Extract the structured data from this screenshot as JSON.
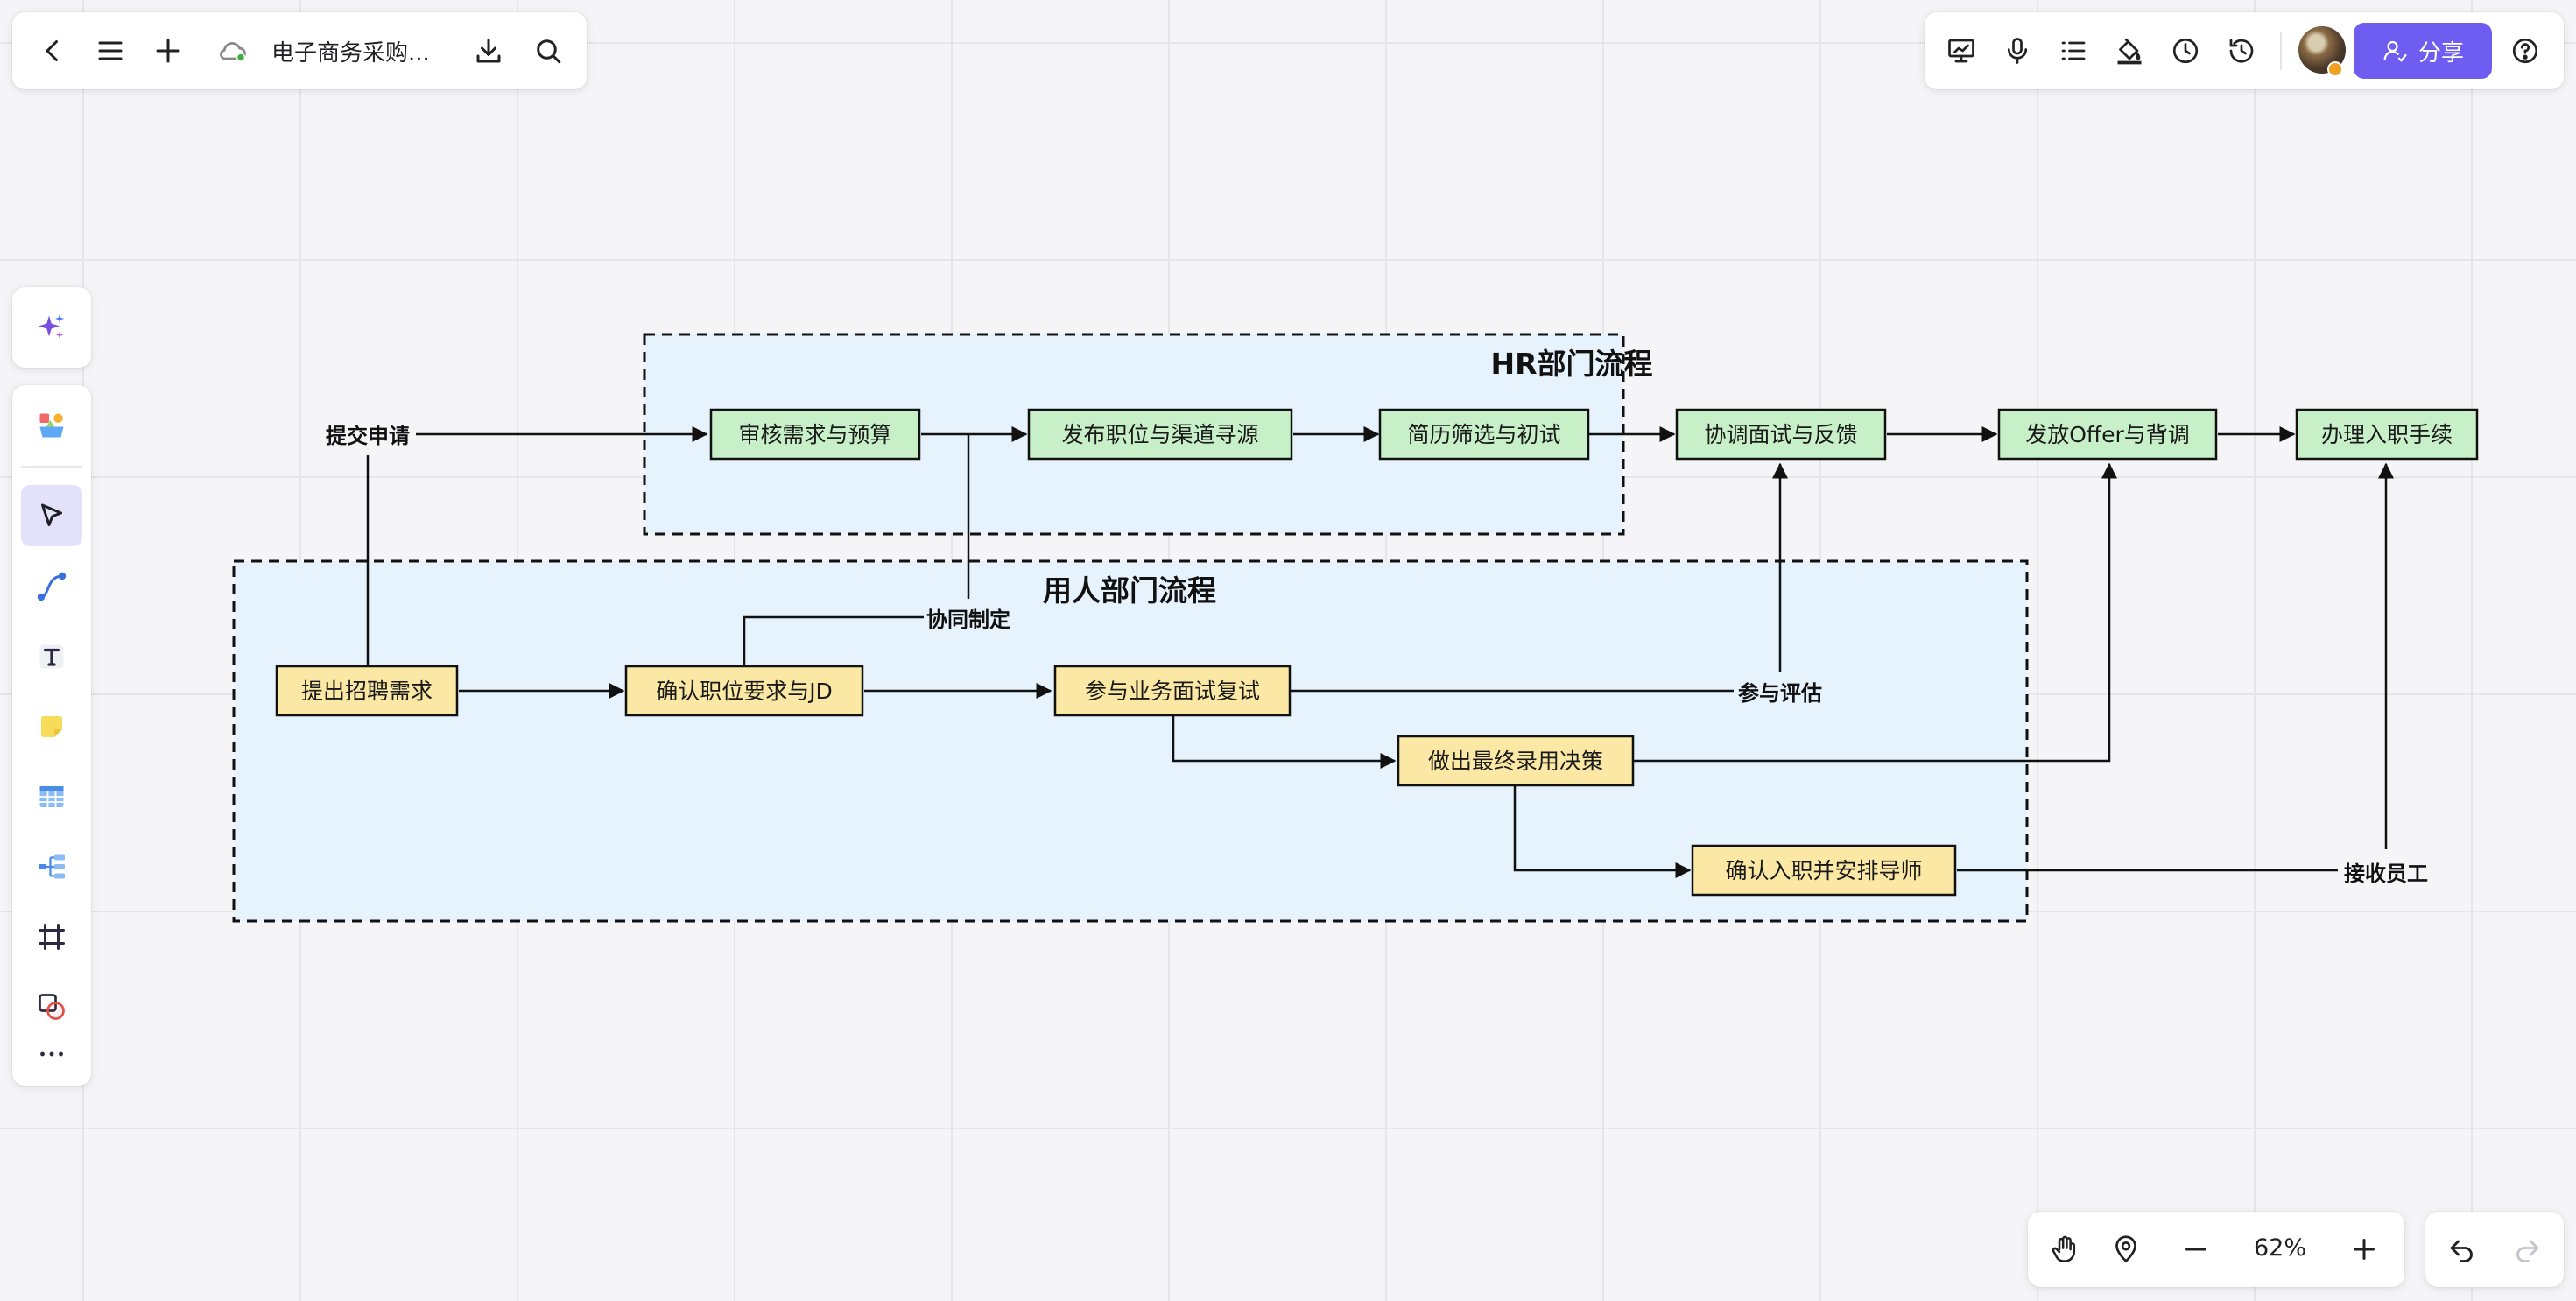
{
  "top_bar": {
    "doc_title": "电子商务采购...",
    "back_icon": "chevron-left-icon",
    "menu_icon": "hamburger-icon",
    "add_icon": "plus-icon",
    "cloud_icon": "cloud-synced-icon",
    "download_icon": "download-icon",
    "search_icon": "search-icon"
  },
  "right_toolbar": {
    "icons": [
      "presentation-icon",
      "microphone-icon",
      "outline-list-icon",
      "format-painter-icon",
      "clock-icon",
      "history-icon"
    ],
    "share_label": "分享",
    "help_icon": "help-circle-icon"
  },
  "left_toolbar": {
    "tools": [
      "ai-sparkle-icon",
      "material-library-icon",
      "select-pointer-icon",
      "connector-curve-icon",
      "text-tool-icon",
      "sticky-note-icon",
      "table-icon",
      "mindmap-icon",
      "frame-icon",
      "shape-icon",
      "more-icon"
    ],
    "active_tool": "select-pointer-icon"
  },
  "bottom_bar": {
    "zoom_label": "62%",
    "icons": [
      "hand-pan-icon",
      "location-pin-icon",
      "zoom-out-icon",
      "zoom-in-icon",
      "undo-icon",
      "redo-icon"
    ]
  },
  "diagram": {
    "hr_group_title": "HR部门流程",
    "dept_group_title": "用人部门流程",
    "hr_steps": [
      "审核需求与预算",
      "发布职位与渠道寻源",
      "简历筛选与初试",
      "协调面试与反馈",
      "发放Offer与背调",
      "办理入职手续"
    ],
    "dept_steps": [
      "提出招聘需求",
      "确认职位要求与JD",
      "参与业务面试复试",
      "做出最终录用决策",
      "确认入职并安排导师"
    ],
    "edge_labels": {
      "submit": "提交申请",
      "co_define": "协同制定",
      "evaluate": "参与评估",
      "receive": "接收员工"
    },
    "colors": {
      "hr_fill": "#c8f0c8",
      "dept_fill": "#fbe8a4",
      "group_fill": "#e6f3fd",
      "accent": "#6f5cf0"
    }
  }
}
